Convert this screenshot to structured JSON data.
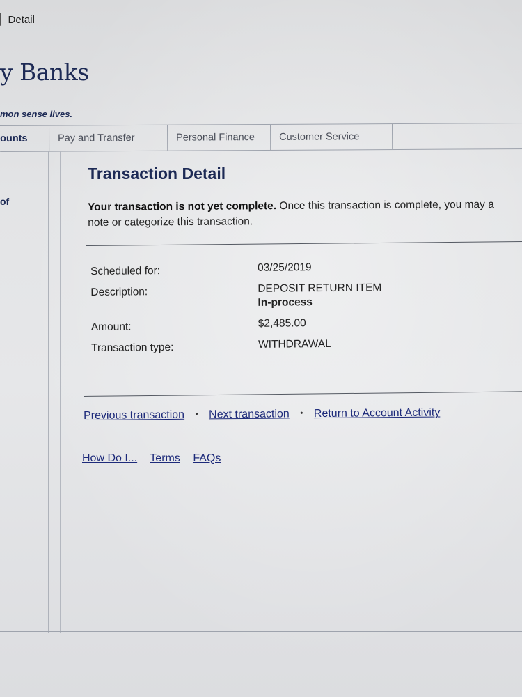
{
  "window": {
    "title_fragment": "Detail"
  },
  "brand": {
    "name_fragment": "y Banks",
    "tagline_fragment": "mon sense lives."
  },
  "nav": {
    "items": [
      {
        "label": "ounts"
      },
      {
        "label": "Pay and Transfer"
      },
      {
        "label": "Personal Finance"
      },
      {
        "label": "Customer Service"
      }
    ]
  },
  "sidebar": {
    "fragment": "of"
  },
  "page": {
    "title": "Transaction Detail",
    "notice_bold": "Your transaction is not yet complete.",
    "notice_text": " Once this transaction is complete, you may a",
    "notice_text_line2": "note or categorize this transaction."
  },
  "details": {
    "scheduled_label": "Scheduled for:",
    "scheduled_value": "03/25/2019",
    "description_label": "Description:",
    "description_value": "DEPOSIT RETURN ITEM",
    "status_value": "In-process",
    "amount_label": "Amount:",
    "amount_value": "$2,485.00",
    "type_label": "Transaction type:",
    "type_value": "WITHDRAWAL"
  },
  "links": {
    "previous": "Previous transaction",
    "next": "Next transaction",
    "return": "Return to Account Activity",
    "separator": "•"
  },
  "footer": {
    "how_do_i": "How Do I...",
    "terms": "Terms",
    "faqs": "FAQs"
  },
  "colors": {
    "brand_navy": "#1d2a55",
    "link_blue": "#1d2a7a",
    "paper": "#e3e4e6"
  }
}
